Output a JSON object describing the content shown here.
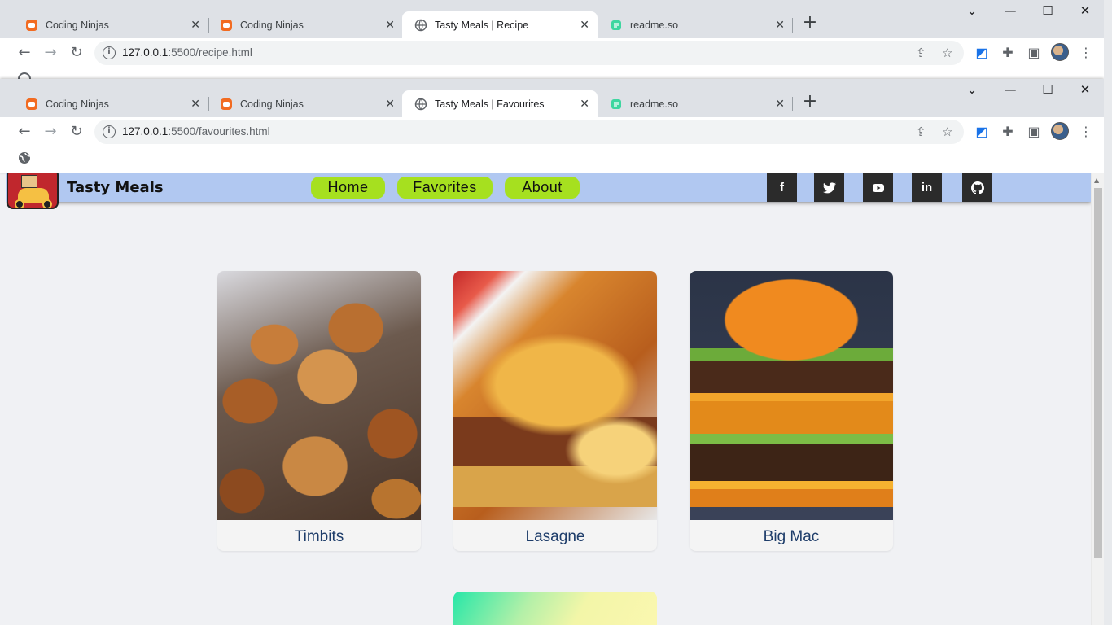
{
  "browser_back": {
    "tabs": [
      {
        "title": "Coding Ninjas"
      },
      {
        "title": "Coding Ninjas"
      },
      {
        "title": "Tasty Meals | Recipe"
      },
      {
        "title": "readme.so"
      }
    ],
    "url_host": "127.0.0.1",
    "url_path": ":5500/recipe.html"
  },
  "browser": {
    "tabs": [
      {
        "title": "Coding Ninjas"
      },
      {
        "title": "Coding Ninjas"
      },
      {
        "title": "Tasty Meals | Favourites"
      },
      {
        "title": "readme.so"
      }
    ],
    "url_host": "127.0.0.1",
    "url_path": ":5500/favourites.html",
    "window_controls": {
      "minimize": "—",
      "maximize": "☐",
      "close": "✕"
    }
  },
  "site": {
    "brand": "Tasty Meals",
    "nav": {
      "home": "Home",
      "favorites": "Favorites",
      "about": "About"
    },
    "social": {
      "facebook": "f",
      "twitter": "t",
      "youtube": "▶",
      "linkedin": "in",
      "github": "gh"
    }
  },
  "favourites": [
    {
      "name": "Timbits"
    },
    {
      "name": "Lasagne"
    },
    {
      "name": "Big Mac"
    }
  ],
  "colors": {
    "navbar": "#b1c8f1",
    "nav_button": "#a6e01f",
    "card_title": "#1e3d6a",
    "social_bg": "#2b2b2b"
  }
}
